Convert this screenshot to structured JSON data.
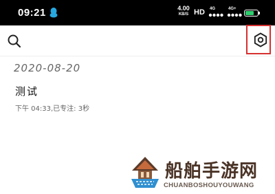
{
  "status_bar": {
    "time": "09:21",
    "net_speed_value": "4.00",
    "net_speed_unit": "KB/S",
    "hd_label": "HD",
    "signal1_label": "4G",
    "signal2_label": "4G+"
  },
  "toolbar": {
    "search_icon": "search-icon",
    "settings_icon": "gear-icon"
  },
  "notes": {
    "group_date": "2020-08-20",
    "items": [
      {
        "title": "测试",
        "meta": "下午 04:33,已专注: 3秒"
      }
    ]
  },
  "watermark": {
    "name": "船舶手游网",
    "pinyin": "CHUANBOSHOUYOUWANG"
  },
  "colors": {
    "status_bar_bg": "#000000",
    "highlight": "#d63030",
    "battery": "#2fcf6f",
    "date_text": "#666666"
  }
}
